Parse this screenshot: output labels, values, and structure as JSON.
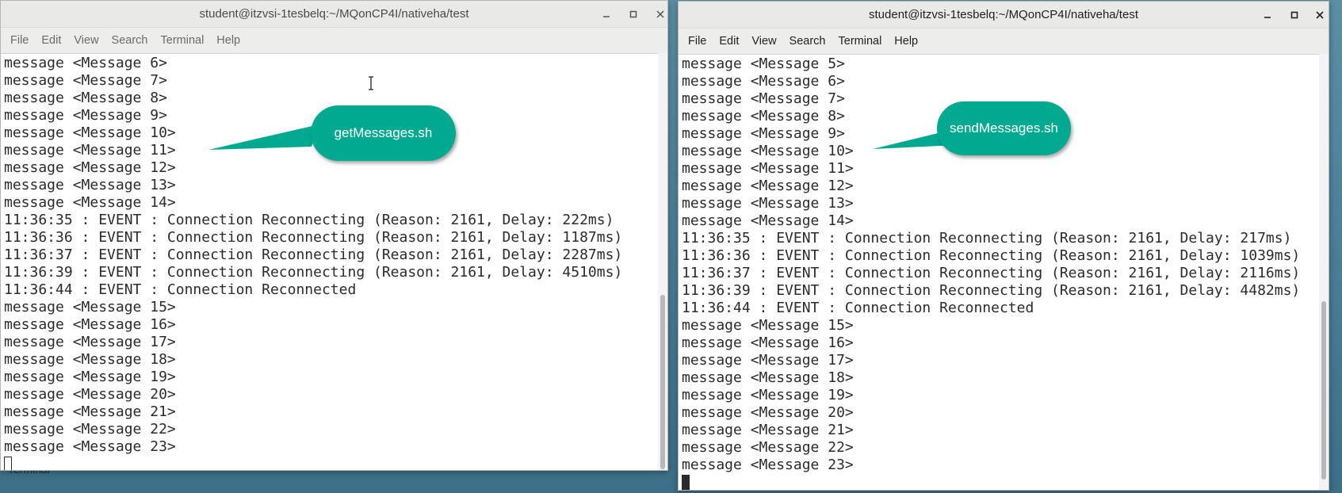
{
  "desktop": {
    "taskbar_label": "Terminal"
  },
  "windows": [
    {
      "title": "student@itzvsi-1tesbelq:~/MQonCP4I/nativeha/test",
      "menu": [
        "File",
        "Edit",
        "View",
        "Search",
        "Terminal",
        "Help"
      ],
      "lines": [
        "message <Message 6>",
        "message <Message 7>",
        "message <Message 8>",
        "message <Message 9>",
        "message <Message 10>",
        "message <Message 11>",
        "message <Message 12>",
        "message <Message 13>",
        "message <Message 14>",
        "11:36:35 : EVENT : Connection Reconnecting (Reason: 2161, Delay: 222ms)",
        "11:36:36 : EVENT : Connection Reconnecting (Reason: 2161, Delay: 1187ms)",
        "11:36:37 : EVENT : Connection Reconnecting (Reason: 2161, Delay: 2287ms)",
        "11:36:39 : EVENT : Connection Reconnecting (Reason: 2161, Delay: 4510ms)",
        "11:36:44 : EVENT : Connection Reconnected",
        "message <Message 15>",
        "message <Message 16>",
        "message <Message 17>",
        "message <Message 18>",
        "message <Message 19>",
        "message <Message 20>",
        "message <Message 21>",
        "message <Message 22>",
        "message <Message 23>"
      ],
      "callout": "getMessages.sh"
    },
    {
      "title": "student@itzvsi-1tesbelq:~/MQonCP4I/nativeha/test",
      "menu": [
        "File",
        "Edit",
        "View",
        "Search",
        "Terminal",
        "Help"
      ],
      "lines": [
        "message <Message 5>",
        "message <Message 6>",
        "message <Message 7>",
        "message <Message 8>",
        "message <Message 9>",
        "message <Message 10>",
        "message <Message 11>",
        "message <Message 12>",
        "message <Message 13>",
        "message <Message 14>",
        "11:36:35 : EVENT : Connection Reconnecting (Reason: 2161, Delay: 217ms)",
        "11:36:36 : EVENT : Connection Reconnecting (Reason: 2161, Delay: 1039ms)",
        "11:36:37 : EVENT : Connection Reconnecting (Reason: 2161, Delay: 2116ms)",
        "11:36:39 : EVENT : Connection Reconnecting (Reason: 2161, Delay: 4482ms)",
        "11:36:44 : EVENT : Connection Reconnected",
        "message <Message 15>",
        "message <Message 16>",
        "message <Message 17>",
        "message <Message 18>",
        "message <Message 19>",
        "message <Message 20>",
        "message <Message 21>",
        "message <Message 22>",
        "message <Message 23>"
      ],
      "callout": "sendMessages.sh"
    }
  ],
  "colors": {
    "callout": "#00a98f",
    "terminal_text": "#2b2b2b",
    "desktop": "#4a7e96"
  },
  "icons": {
    "minimize": "minimize-icon",
    "maximize": "maximize-icon",
    "close": "close-icon"
  }
}
